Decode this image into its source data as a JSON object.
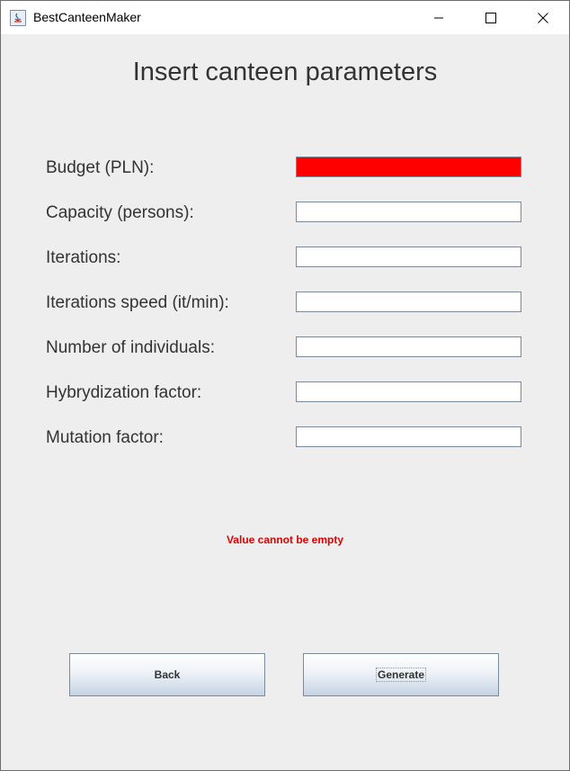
{
  "window": {
    "title": "BestCanteenMaker"
  },
  "form": {
    "heading": "Insert canteen parameters",
    "fields": [
      {
        "label": "Budget (PLN):",
        "value": "",
        "error": true
      },
      {
        "label": "Capacity (persons):",
        "value": ""
      },
      {
        "label": "Iterations:",
        "value": ""
      },
      {
        "label": "Iterations speed (it/min):",
        "value": ""
      },
      {
        "label": "Number of individuals:",
        "value": ""
      },
      {
        "label": "Hybrydization factor:",
        "value": ""
      },
      {
        "label": "Mutation factor:",
        "value": ""
      }
    ],
    "error_message": "Value cannot be empty",
    "error_color": "#ff0000"
  },
  "buttons": {
    "back": "Back",
    "generate": "Generate"
  }
}
